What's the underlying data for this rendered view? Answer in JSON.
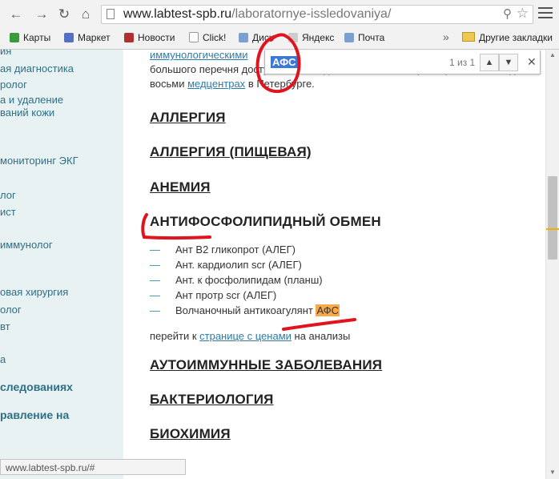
{
  "browser": {
    "url_host": "www.labtest-spb.ru",
    "url_path": "/laboratornye-issledovaniya/",
    "bookmarks": [
      {
        "label": "Карты",
        "icon": "maps-icon",
        "color": "#3a9b3a"
      },
      {
        "label": "Маркет",
        "icon": "market-icon",
        "color": "#5470c4"
      },
      {
        "label": "Новости",
        "icon": "news-icon",
        "color": "#b03030"
      },
      {
        "label": "Click!",
        "icon": "page-icon",
        "color": "#ffffff"
      },
      {
        "label": "Диск",
        "icon": "mail-icon",
        "color": "#7a9fd0"
      },
      {
        "label": "Яндекс",
        "icon": "yandex-icon",
        "color": "#cccccc"
      },
      {
        "label": "Почта",
        "icon": "mail-icon",
        "color": "#7a9fd0"
      }
    ],
    "other_bookmarks": "Другие закладки",
    "status_url": "www.labtest-spb.ru/#"
  },
  "find_bar": {
    "query": "АФС",
    "count": "1 из 1"
  },
  "sidebar": {
    "items": [
      {
        "label": "ия",
        "bold": false
      },
      {
        "label": "ая диагностика",
        "bold": false
      },
      {
        "label": "ролог",
        "bold": false
      },
      {
        "label": "а и удаление",
        "bold": false
      },
      {
        "label": "ваний кожи",
        "bold": false
      },
      {
        "label": "мониторинг ЭКГ",
        "bold": false
      },
      {
        "label": "лог",
        "bold": false
      },
      {
        "label": "ист",
        "bold": false
      },
      {
        "label": "иммунолог",
        "bold": false
      },
      {
        "label": "овая хирургия",
        "bold": false
      },
      {
        "label": "олог",
        "bold": false
      },
      {
        "label": "вт",
        "bold": false
      },
      {
        "label": "а",
        "bold": false
      },
      {
        "label": "следованиях",
        "bold": true
      },
      {
        "label": "равление на",
        "bold": true
      }
    ]
  },
  "content": {
    "intro_line1_link": "иммунологическими",
    "intro_line2": "большого перечня доступных исследований. Ниже общий перечень исследо-",
    "intro_line3_pre": "восьми",
    "intro_line3_link": "медцентрах",
    "intro_line3_post": "в Петербурге.",
    "headings_top": [
      "АЛЛЕРГИЯ",
      "АЛЛЕРГИЯ (ПИЩЕВАЯ)",
      "АНЕМИЯ"
    ],
    "active_heading": "АНТИФОСФОЛИПИДНЫЙ ОБМЕН",
    "subitems": [
      {
        "text": "Ант В2 гликопрот (АЛЕГ)",
        "highlight": ""
      },
      {
        "text": "Ант. кардиолип scr (АЛЕГ)",
        "highlight": ""
      },
      {
        "text": "Ант. к фосфолипидам (планш)",
        "highlight": ""
      },
      {
        "text": "Ант протр scr (АЛЕГ)",
        "highlight": ""
      },
      {
        "text": "Волчаночный антикоагулянт",
        "highlight": "АФС"
      }
    ],
    "dash": "—",
    "price_pre": "перейти к",
    "price_link": "странице с ценами",
    "price_post": "на анализы",
    "headings_bottom": [
      "АУТОИММУННЫЕ ЗАБОЛЕВАНИЯ",
      "БАКТЕРИОЛОГИЯ",
      "БИОХИМИЯ"
    ]
  },
  "colors": {
    "link": "#2e7aa6",
    "highlight": "#f9a94b",
    "annotation": "#e0141e",
    "find_selection": "#3b78d8"
  }
}
